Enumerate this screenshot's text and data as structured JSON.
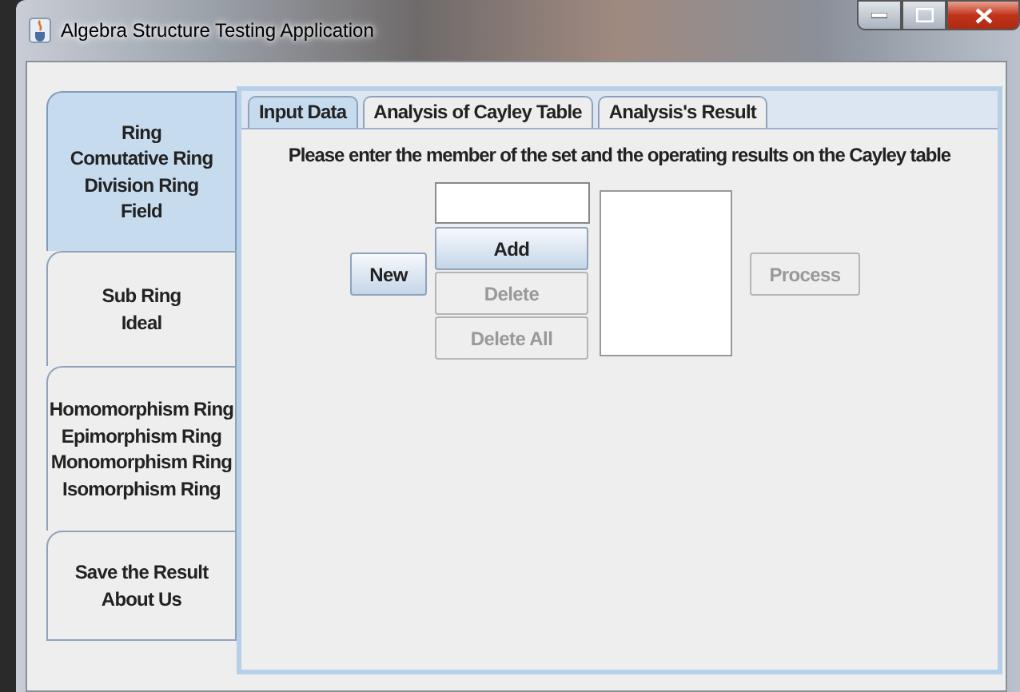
{
  "window": {
    "title": "Algebra Structure Testing Application"
  },
  "sidebar": {
    "items": [
      {
        "lines": [
          "Ring",
          "Comutative Ring",
          "Division Ring",
          "Field"
        ],
        "selected": true
      },
      {
        "lines": [
          "Sub Ring",
          "Ideal"
        ],
        "selected": false
      },
      {
        "lines": [
          "Homomorphism Ring",
          "Epimorphism Ring",
          "Monomorphism Ring",
          "Isomorphism Ring"
        ],
        "selected": false
      },
      {
        "lines": [
          "Save the Result",
          "About Us"
        ],
        "selected": false
      }
    ]
  },
  "tabs": [
    {
      "label": "Input Data",
      "selected": true
    },
    {
      "label": "Analysis of Cayley Table",
      "selected": false
    },
    {
      "label": "Analysis's Result",
      "selected": false
    }
  ],
  "input_data": {
    "instruction": "Please enter the member of the set and the operating results on the Cayley table",
    "new_button": {
      "label": "New",
      "disabled": false
    },
    "add_button": {
      "label": "Add",
      "disabled": false
    },
    "delete_button": {
      "label": "Delete",
      "disabled": true
    },
    "delete_all_button": {
      "label": "Delete All",
      "disabled": true
    },
    "process_button": {
      "label": "Process",
      "disabled": true
    }
  }
}
